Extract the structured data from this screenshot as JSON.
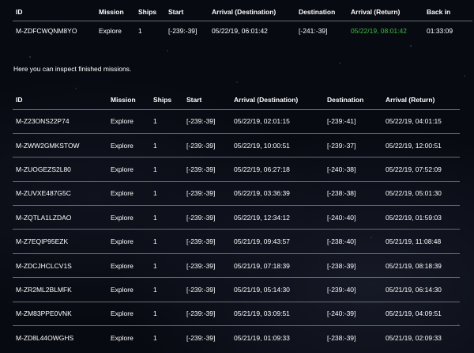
{
  "active_missions": {
    "headers": [
      "ID",
      "Mission",
      "Ships",
      "Start",
      "Arrival (Destination)",
      "Destination",
      "Arrival (Return)",
      "Back in"
    ],
    "rows": [
      [
        "M-ZDFCWQNM8YO",
        "Explore",
        "1",
        "[-239:-39]",
        "05/22/19, 06:01:42",
        "[-241:-39]",
        "05/22/19, 08:01:42",
        "01:33:09"
      ]
    ],
    "return_color": "#3dbb3d"
  },
  "intro_text": "Here you can inspect finished missions.",
  "finished_missions": {
    "headers": [
      "ID",
      "Mission",
      "Ships",
      "Start",
      "Arrival (Destination)",
      "Destination",
      "Arrival (Return)"
    ],
    "rows": [
      [
        "M-Z23ONS22P74",
        "Explore",
        "1",
        "[-239:-39]",
        "05/22/19, 02:01:15",
        "[-239:-41]",
        "05/22/19, 04:01:15"
      ],
      [
        "M-ZWW2GMKSTOW",
        "Explore",
        "1",
        "[-239:-39]",
        "05/22/19, 10:00:51",
        "[-239:-37]",
        "05/22/19, 12:00:51"
      ],
      [
        "M-ZUOGEZS2L80",
        "Explore",
        "1",
        "[-239:-39]",
        "05/22/19, 06:27:18",
        "[-240:-38]",
        "05/22/19, 07:52:09"
      ],
      [
        "M-ZUVXE487G5C",
        "Explore",
        "1",
        "[-239:-39]",
        "05/22/19, 03:36:39",
        "[-238:-38]",
        "05/22/19, 05:01:30"
      ],
      [
        "M-ZQTLA1LZDAO",
        "Explore",
        "1",
        "[-239:-39]",
        "05/22/19, 12:34:12",
        "[-240:-40]",
        "05/22/19, 01:59:03"
      ],
      [
        "M-Z7EQIP95EZK",
        "Explore",
        "1",
        "[-239:-39]",
        "05/21/19, 09:43:57",
        "[-238:-40]",
        "05/21/19, 11:08:48"
      ],
      [
        "M-ZDCJHCLCV1S",
        "Explore",
        "1",
        "[-239:-39]",
        "05/21/19, 07:18:39",
        "[-238:-39]",
        "05/21/19, 08:18:39"
      ],
      [
        "M-ZR2ML2BLMFK",
        "Explore",
        "1",
        "[-239:-39]",
        "05/21/19, 05:14:30",
        "[-239:-40]",
        "05/21/19, 06:14:30"
      ],
      [
        "M-ZM83PPE0VNK",
        "Explore",
        "1",
        "[-239:-39]",
        "05/21/19, 03:09:51",
        "[-240:-39]",
        "05/21/19, 04:09:51"
      ],
      [
        "M-ZD8L44OWGHS",
        "Explore",
        "1",
        "[-239:-39]",
        "05/21/19, 01:09:33",
        "[-238:-39]",
        "05/21/19, 02:09:33"
      ]
    ]
  }
}
